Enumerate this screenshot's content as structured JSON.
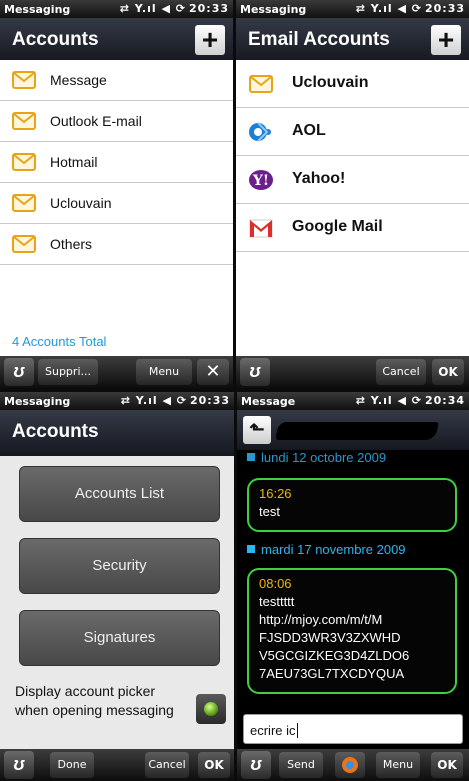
{
  "q1": {
    "status": {
      "app": "Messaging",
      "time": "20:33"
    },
    "title": "Accounts",
    "plus_label": "+",
    "accounts": [
      {
        "label": "Message"
      },
      {
        "label": "Outlook E-mail"
      },
      {
        "label": "Hotmail"
      },
      {
        "label": "Uclouvain"
      },
      {
        "label": "Others"
      }
    ],
    "total": "4 Accounts Total",
    "softkeys": {
      "left": "Suppri...",
      "right": "Menu",
      "close": "✕"
    }
  },
  "q2": {
    "status": {
      "app": "Messaging",
      "time": "20:33"
    },
    "title": "Email Accounts",
    "plus_label": "+",
    "providers": [
      {
        "label": "Uclouvain",
        "icon": "envelope-icon"
      },
      {
        "label": "AOL",
        "icon": "aol-icon"
      },
      {
        "label": "Yahoo!",
        "icon": "yahoo-icon"
      },
      {
        "label": "Google Mail",
        "icon": "gmail-icon"
      }
    ],
    "softkeys": {
      "left": "Cancel",
      "right": "OK"
    }
  },
  "q3": {
    "status": {
      "app": "Messaging",
      "time": "20:33"
    },
    "title": "Accounts",
    "buttons": {
      "list": "Accounts List",
      "security": "Security",
      "signatures": "Signatures"
    },
    "picker_label": "Display account picker when opening messaging",
    "softkeys": {
      "done": "Done",
      "cancel": "Cancel",
      "ok": "OK"
    }
  },
  "q4": {
    "status": {
      "app": "Message",
      "time": "20:34"
    },
    "date1": "lundi 12 octobre 2009",
    "msg1": {
      "time": "16:26",
      "text": "test"
    },
    "date2": "mardi 17 novembre 2009",
    "msg2": {
      "time": "08:06",
      "lines": [
        "testtttt",
        "http://mjoy.com/m/t/M",
        "FJSDD3WR3V3ZXWHD",
        "V5GCGIZKEG3D4ZLDO6",
        "7AEU73GL7TXCDYQUA"
      ]
    },
    "input_value": "ecrire ic",
    "softkeys": {
      "send": "Send",
      "menu": "Menu",
      "ok": "OK"
    }
  },
  "colors": {
    "accent_blue": "#1e9ad8",
    "bubble_border": "#3fcf3f",
    "time_orange": "#f0b800",
    "date_blue": "#2bb6f0"
  }
}
